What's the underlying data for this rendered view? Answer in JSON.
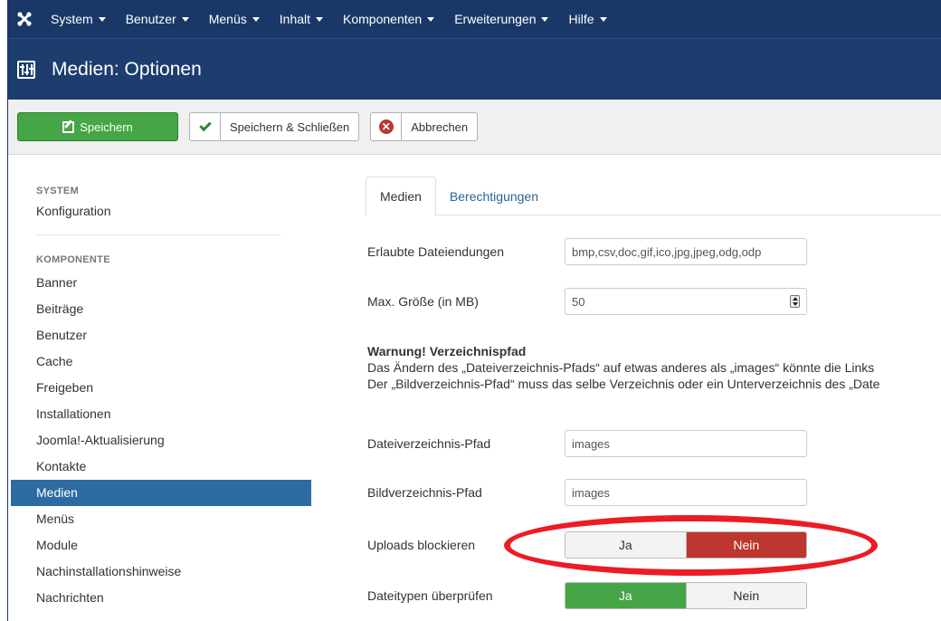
{
  "navbar": {
    "logo_icon": "joomla-logo-icon",
    "menus": [
      {
        "label": "System"
      },
      {
        "label": "Benutzer"
      },
      {
        "label": "Menüs"
      },
      {
        "label": "Inhalt"
      },
      {
        "label": "Komponenten"
      },
      {
        "label": "Erweiterungen"
      },
      {
        "label": "Hilfe"
      }
    ]
  },
  "header": {
    "icon": "options-sliders-icon",
    "title": "Medien: Optionen"
  },
  "toolbar": {
    "save_label": "Speichern",
    "save_close_label": "Speichern & Schließen",
    "cancel_label": "Abbrechen",
    "cancel_icon_glyph": "✕"
  },
  "sidebar": {
    "system_heading": "SYSTEM",
    "system_items": [
      {
        "label": "Konfiguration"
      }
    ],
    "component_heading": "KOMPONENTE",
    "component_items": [
      {
        "label": "Banner"
      },
      {
        "label": "Beiträge"
      },
      {
        "label": "Benutzer"
      },
      {
        "label": "Cache"
      },
      {
        "label": "Freigeben"
      },
      {
        "label": "Installationen"
      },
      {
        "label": "Joomla!-Aktualisierung"
      },
      {
        "label": "Kontakte"
      },
      {
        "label": "Medien",
        "active": true
      },
      {
        "label": "Menüs"
      },
      {
        "label": "Module"
      },
      {
        "label": "Nachinstallationshinweise"
      },
      {
        "label": "Nachrichten"
      }
    ]
  },
  "main": {
    "tabs": [
      {
        "label": "Medien",
        "active": true
      },
      {
        "label": "Berechtigungen"
      }
    ],
    "fields": {
      "extensions": {
        "label": "Erlaubte Dateiendungen",
        "value": "bmp,csv,doc,gif,ico,jpg,jpeg,odg,odp"
      },
      "max_size": {
        "label": "Max. Größe (in MB)",
        "value": "50"
      },
      "file_path": {
        "label": "Dateiverzeichnis-Pfad",
        "value": "images"
      },
      "image_path": {
        "label": "Bildverzeichnis-Pfad",
        "value": "images"
      },
      "restrict_uploads": {
        "label": "Uploads blockieren",
        "yes": "Ja",
        "no": "Nein",
        "selected": "Nein"
      },
      "check_mime": {
        "label": "Dateitypen überprüfen",
        "yes": "Ja",
        "no": "Nein",
        "selected": "Ja"
      }
    },
    "warning": {
      "title": "Warnung! Verzeichnispfad",
      "line1": "Das Ändern des „Dateiverzeichnis-Pfads“ auf etwas anderes als „images“ könnte die Links",
      "line2": "Der „Bildverzeichnis-Pfad“ muss das selbe Verzeichnis oder ein Unterverzeichnis des „Date"
    }
  },
  "colors": {
    "navbar_bg": "#1a3867",
    "title_bg": "#1c3d6e",
    "save_green": "#46a546",
    "active_blue": "#2d6ca2",
    "no_red": "#bd362f",
    "annotation_red": "#ec1c24"
  }
}
